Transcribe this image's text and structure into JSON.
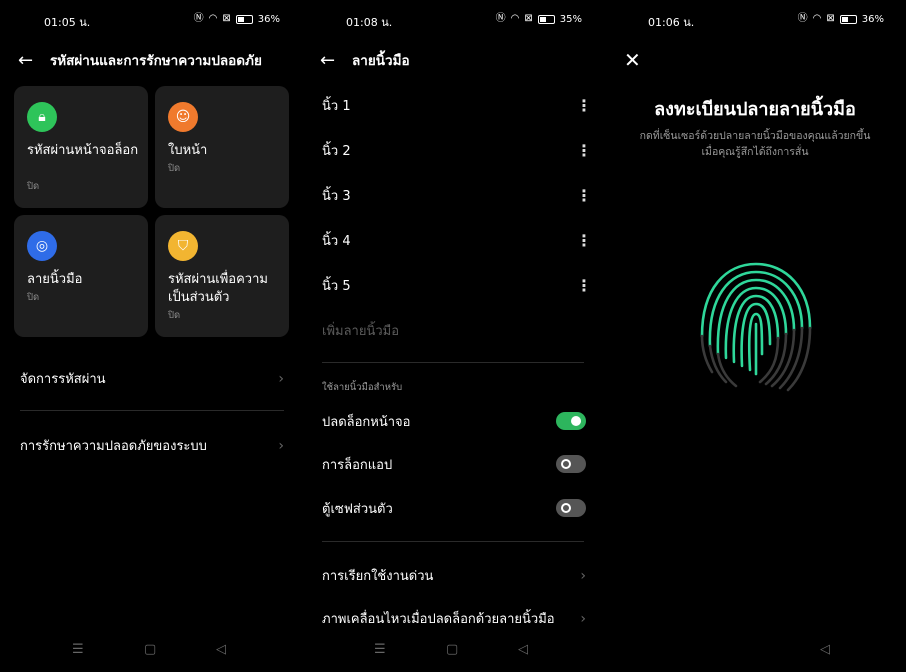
{
  "screen1": {
    "status": {
      "time": "01:05 น.",
      "battery": "36%"
    },
    "header": {
      "title": "รหัสผ่านและการรักษาความปลอดภัย"
    },
    "cards": [
      {
        "title": "รหัสผ่านหน้าจอล็อก",
        "sub": "ปิด",
        "icon": "lock-icon",
        "color": "#2ec45a"
      },
      {
        "title": "ใบหน้า",
        "sub": "ปิด",
        "icon": "face-icon",
        "color": "#f07a2d"
      },
      {
        "title": "ลายนิ้วมือ",
        "sub": "ปิด",
        "icon": "fingerprint-icon",
        "color": "#2f6ce8"
      },
      {
        "title": "รหัสผ่านเพื่อความเป็นส่วนตัว",
        "sub": "ปิด",
        "icon": "shield-icon",
        "color": "#f2b531"
      }
    ],
    "rows": [
      {
        "label": "จัดการรหัสผ่าน"
      },
      {
        "label": "การรักษาความปลอดภัยของระบบ"
      }
    ]
  },
  "screen2": {
    "status": {
      "time": "01:08 น.",
      "battery": "35%"
    },
    "header": {
      "title": "ลายนิ้วมือ"
    },
    "fingers": [
      "นิ้ว 1",
      "นิ้ว 2",
      "นิ้ว 3",
      "นิ้ว 4",
      "นิ้ว 5"
    ],
    "add_fingerprint": "เพิ่มลายนิ้วมือ",
    "section_label": "ใช้ลายนิ้วมือสำหรับ",
    "toggles": [
      {
        "label": "ปลดล็อกหน้าจอ",
        "on": true
      },
      {
        "label": "การล็อกแอป",
        "on": false
      },
      {
        "label": "ตู้เซฟส่วนตัว",
        "on": false
      }
    ],
    "rows": [
      {
        "label": "การเรียกใช้งานด่วน"
      },
      {
        "label": "ภาพเคลื่อนไหวเมื่อปลดล็อกด้วยลายนิ้วมือ"
      }
    ]
  },
  "screen3": {
    "status": {
      "time": "01:06 น.",
      "battery": "36%"
    },
    "title": "ลงทะเบียนปลายลายนิ้วมือ",
    "subtitle_line1": "กดที่เซ็นเซอร์ด้วยปลายลายนิ้วมือของคุณแล้วยกขึ้น",
    "subtitle_line2": "เมื่อคุณรู้สึกได้ถึงการสั่น",
    "accent": "#2fd79a"
  }
}
